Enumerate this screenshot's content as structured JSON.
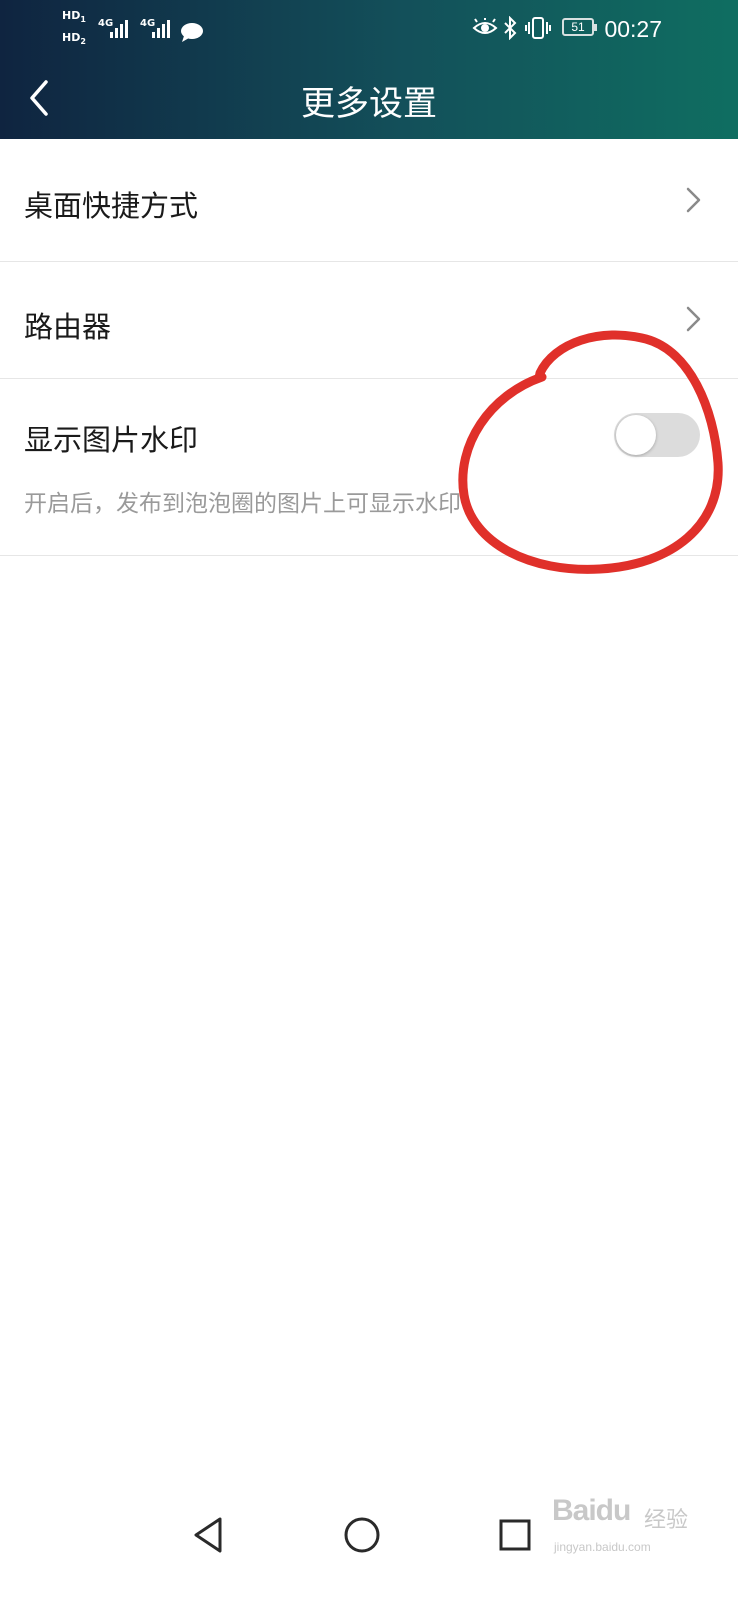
{
  "status_bar": {
    "sim1": "HD",
    "sim1_index": "1",
    "sim2": "HD",
    "sim2_index": "2",
    "network1": "4G",
    "network2": "4G",
    "battery": "51",
    "time": "00:27"
  },
  "header": {
    "title": "更多设置",
    "background_start": "#0f2440",
    "background_end": "#0f6e61"
  },
  "settings": {
    "shortcut_label": "桌面快捷方式",
    "router_label": "路由器",
    "watermark_label": "显示图片水印",
    "watermark_desc": "开启后，发布到泡泡圈的图片上可显示水印",
    "watermark_enabled": false
  },
  "annotation_color": "#e0302a",
  "watermark": {
    "brand": "Baidu",
    "sub": "经验",
    "url": "jingyan.baidu.com"
  }
}
